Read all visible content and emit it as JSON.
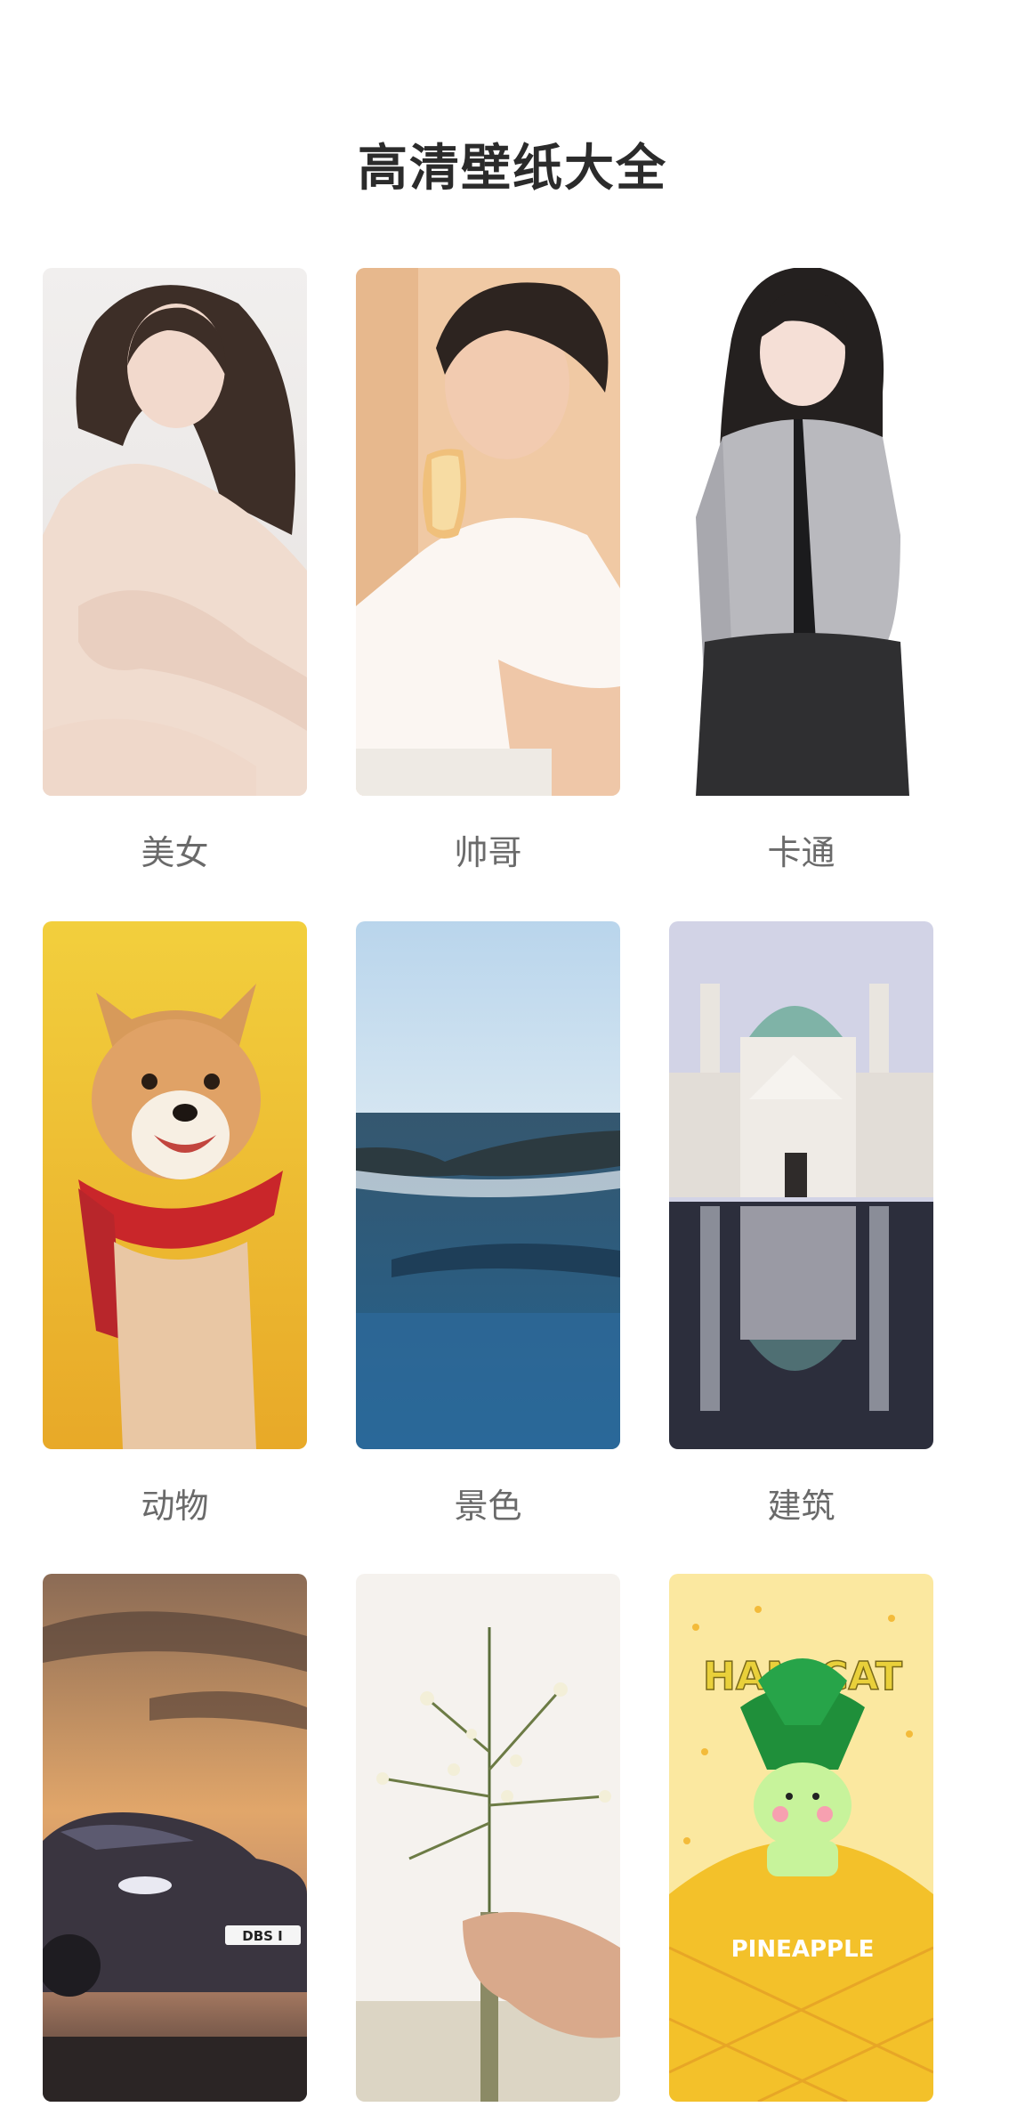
{
  "page": {
    "title": "高清壁纸大全"
  },
  "categories": [
    {
      "label": "美女",
      "image_icon": "portrait-woman"
    },
    {
      "label": "帅哥",
      "image_icon": "portrait-man-with-toast"
    },
    {
      "label": "卡通",
      "image_icon": "anime-girl"
    },
    {
      "label": "动物",
      "image_icon": "shiba-dog-with-scarf"
    },
    {
      "label": "景色",
      "image_icon": "ocean-waves"
    },
    {
      "label": "建筑",
      "image_icon": "baroque-church-reflection"
    },
    {
      "label": "",
      "image_icon": "sports-car-sunset"
    },
    {
      "label": "",
      "image_icon": "wildflower-bouquet"
    },
    {
      "label": "",
      "image_icon": "pineapple-cartoon"
    }
  ],
  "pineapple": {
    "line1": "HAMICAT",
    "line2": "PINEAPPLE"
  },
  "car": {
    "plate": "DBS I"
  },
  "colors": {
    "title": "#2b2b2b",
    "label": "#6a6a6a",
    "background": "#ffffff"
  }
}
